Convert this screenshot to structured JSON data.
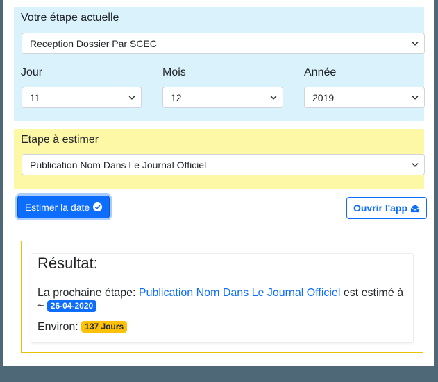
{
  "current_step": {
    "label": "Votre étape actuelle",
    "selected": "Reception Dossier Par SCEC"
  },
  "date": {
    "day": {
      "label": "Jour",
      "selected": "11"
    },
    "month": {
      "label": "Mois",
      "selected": "12"
    },
    "year": {
      "label": "Année",
      "selected": "2019"
    }
  },
  "target_step": {
    "label": "Etape à estimer",
    "selected": "Publication Nom Dans Le Journal Officiel"
  },
  "actions": {
    "estimate_label": "Estimer la date",
    "open_app_label": "Ouvrir l'app"
  },
  "result": {
    "title": "Résultat:",
    "prefix": "La prochaine étape: ",
    "step_link": "Publication Nom Dans Le Journal Officiel",
    "estimated_text": " est estimé à ~ ",
    "estimated_date": "26-04-2020",
    "approx_label": "Environ: ",
    "approx_days": "137 Jours"
  },
  "colors": {
    "primary": "#0d6efd",
    "info_bg": "#d9f2fc",
    "warning_bg": "#fdf8a6",
    "badge_warning": "#ffc107"
  },
  "icons": {
    "estimate": "check-circle-icon",
    "open_app": "envelope-open-icon",
    "select": "chevron-down-icon"
  }
}
